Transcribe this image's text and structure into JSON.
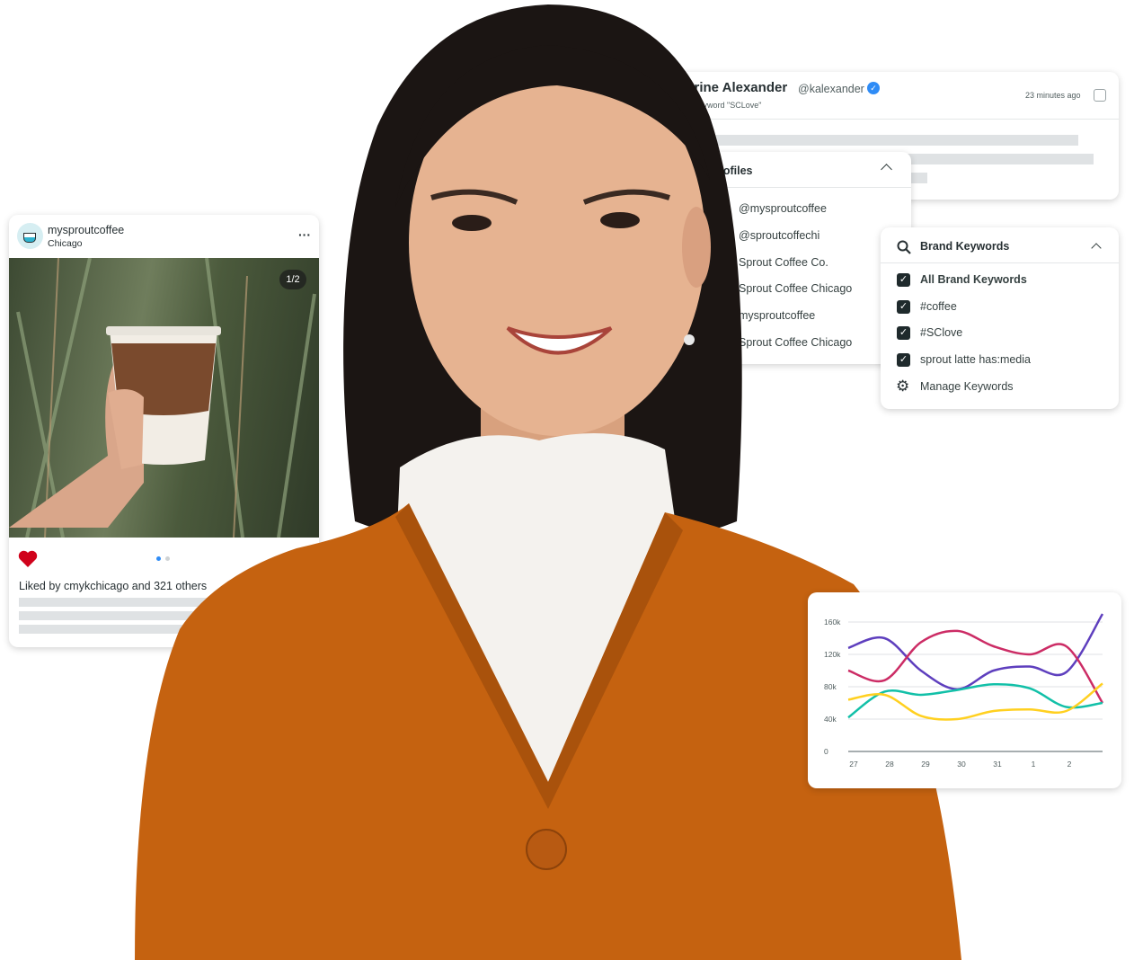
{
  "tweet": {
    "name": "herine Alexander",
    "handle": "@kalexander",
    "subtitle": "keyword \"SCLove\"",
    "time": "23 minutes ago"
  },
  "profiles": {
    "title": "rofiles",
    "items": [
      "@mysproutcoffee",
      "@sproutcoffechi",
      "Sprout Coffee Co.",
      "Sprout Coffee Chicago",
      "mysproutcoffee",
      "Sprout Coffee Chicago"
    ]
  },
  "instagram": {
    "username": "mysproutcoffee",
    "location": "Chicago",
    "counter": "1/2",
    "liked_prefix": "Liked by ",
    "liked_user": "cmykchicago",
    "liked_suffix": " and 321 others",
    "liked": true,
    "heart_color": "#d0021b",
    "active_dot_color": "#2f8cf6"
  },
  "keywords": {
    "title": "Brand Keywords",
    "items": [
      {
        "label": "All Brand Keywords",
        "checked": true,
        "bold": true
      },
      {
        "label": "#coffee",
        "checked": true
      },
      {
        "label": "#SClove",
        "checked": true
      },
      {
        "label": "sprout latte has:media",
        "checked": true
      }
    ],
    "manage": "Manage Keywords"
  },
  "chart_data": {
    "type": "line",
    "x_tick_labels": [
      "27",
      "28",
      "29",
      "30",
      "31",
      "1",
      "2"
    ],
    "y_tick_labels": [
      "0",
      "40k",
      "80k",
      "120k",
      "160k"
    ],
    "ylim": [
      0,
      170000
    ],
    "grid": true,
    "series": [
      {
        "color": "#5e3fbe",
        "values": [
          128000,
          140000,
          100000,
          77000,
          100000,
          105000,
          98000,
          170000
        ]
      },
      {
        "color": "#cc2c65",
        "values": [
          100000,
          88000,
          135000,
          149000,
          130000,
          120000,
          130000,
          60000
        ]
      },
      {
        "color": "#12c0a8",
        "values": [
          42000,
          74000,
          70000,
          76000,
          83000,
          78000,
          55000,
          60000
        ]
      },
      {
        "color": "#ffd020",
        "values": [
          64000,
          70000,
          44000,
          40000,
          50000,
          52000,
          50000,
          84000
        ]
      }
    ]
  }
}
